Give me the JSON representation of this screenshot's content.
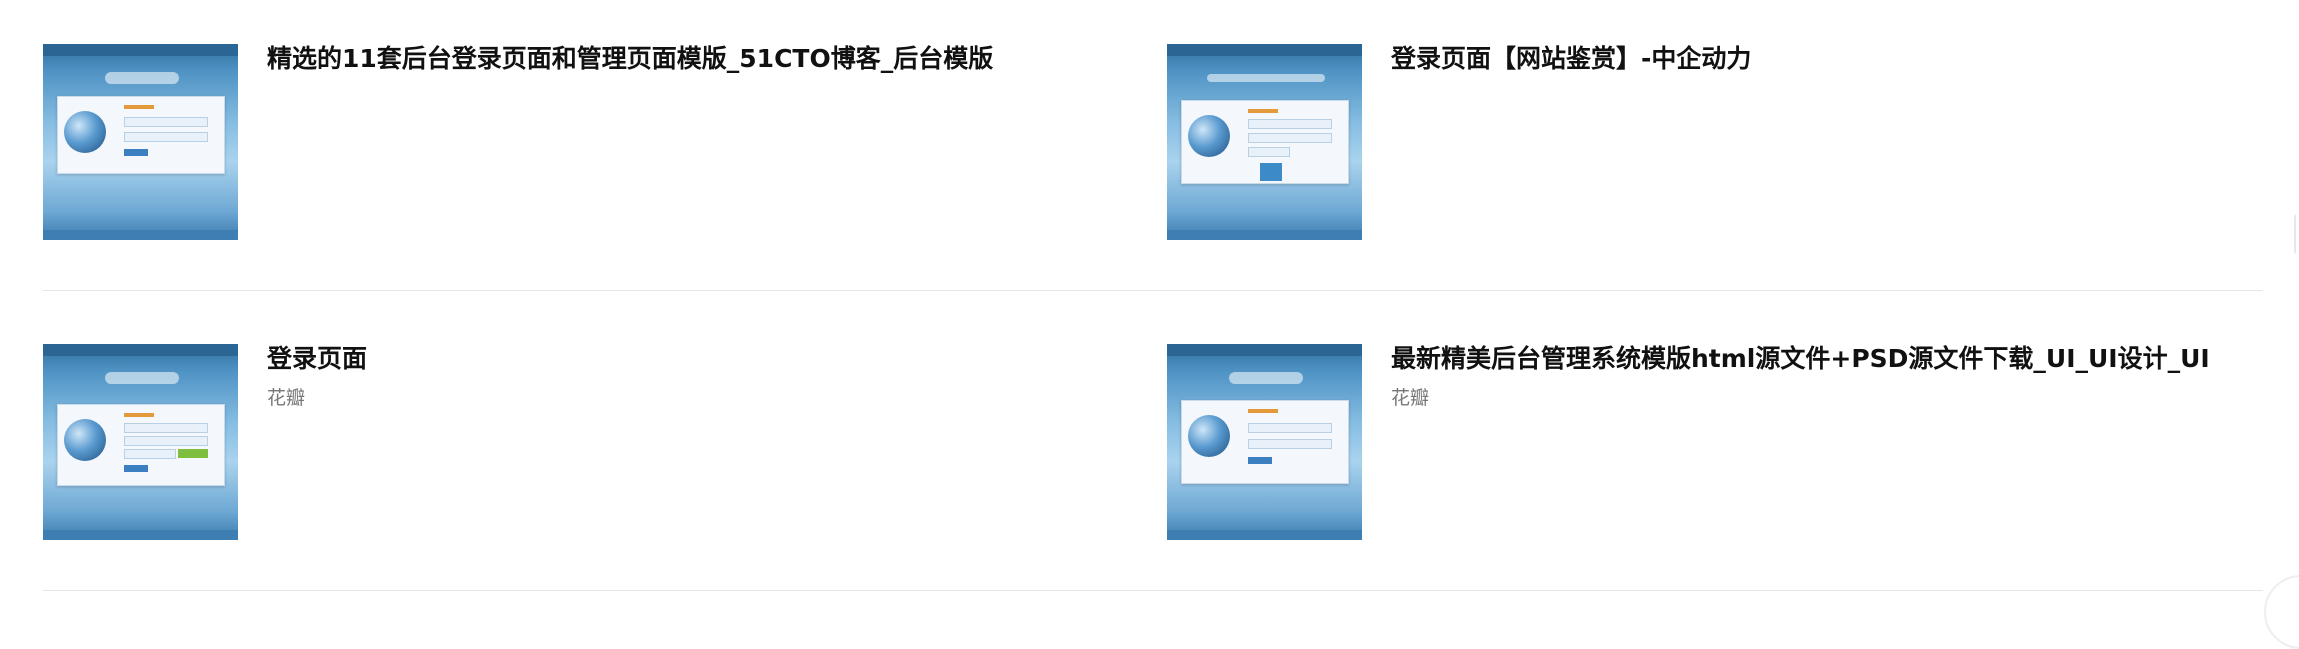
{
  "results": [
    {
      "title": "精选的11套后台登录页面和管理页面模版_51CTO博客_后台模版",
      "source": "",
      "thumbnail_icon": "login-page-thumbnail"
    },
    {
      "title": "登录页面【网站鉴赏】-中企动力",
      "source": "",
      "thumbnail_icon": "login-page-thumbnail"
    },
    {
      "title": "登录页面",
      "source": "花瓣",
      "thumbnail_icon": "login-page-thumbnail"
    },
    {
      "title": "最新精美后台管理系统模版html源文件+PSD源文件下载_UI_UI设计_UI",
      "source": "花瓣",
      "thumbnail_icon": "login-page-thumbnail"
    }
  ],
  "colors": {
    "thumb_blue": "#4f93c4",
    "divider": "#e6e6e6",
    "title": "#111111",
    "source": "#777777"
  }
}
